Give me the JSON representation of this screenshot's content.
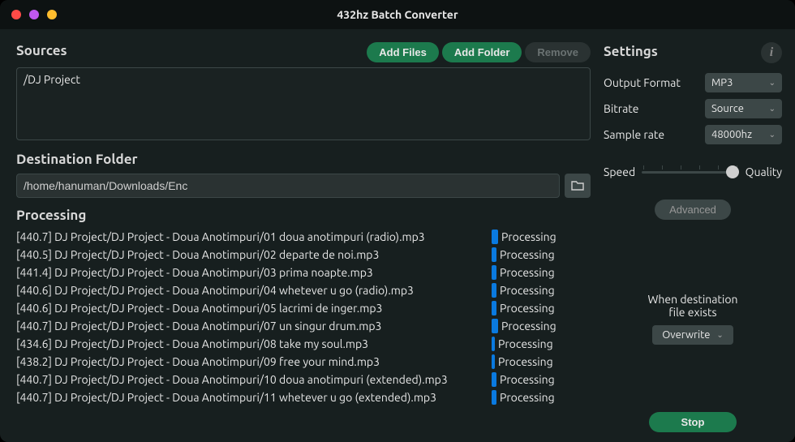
{
  "window": {
    "title": "432hz Batch Converter"
  },
  "sources": {
    "heading": "Sources",
    "add_files": "Add Files",
    "add_folder": "Add Folder",
    "remove": "Remove",
    "items": [
      "/DJ Project"
    ]
  },
  "destination": {
    "heading": "Destination Folder",
    "path": "/home/hanuman/Downloads/Enc"
  },
  "processing": {
    "heading": "Processing",
    "status_label": "Processing",
    "items": [
      {
        "hz": "[440.7]",
        "file": "DJ Project/DJ Project - Doua Anotimpuri/01 doua anotimpuri (radio).mp3",
        "progress": 8
      },
      {
        "hz": "[440.5]",
        "file": "DJ Project/DJ Project - Doua Anotimpuri/02 departe de noi.mp3",
        "progress": 6
      },
      {
        "hz": "[441.4]",
        "file": "DJ Project/DJ Project - Doua Anotimpuri/03 prima noapte.mp3",
        "progress": 6
      },
      {
        "hz": "[440.6]",
        "file": "DJ Project/DJ Project - Doua Anotimpuri/04 whetever u go (radio).mp3",
        "progress": 6
      },
      {
        "hz": "[440.6]",
        "file": "DJ Project/DJ Project - Doua Anotimpuri/05 lacrimi de inger.mp3",
        "progress": 6
      },
      {
        "hz": "[440.7]",
        "file": "DJ Project/DJ Project - Doua Anotimpuri/07 un singur drum.mp3",
        "progress": 8
      },
      {
        "hz": "[434.6]",
        "file": "DJ Project/DJ Project - Doua Anotimpuri/08 take my soul.mp3",
        "progress": 4
      },
      {
        "hz": "[438.2]",
        "file": "DJ Project/DJ Project - Doua Anotimpuri/09 free your mind.mp3",
        "progress": 4
      },
      {
        "hz": "[440.7]",
        "file": "DJ Project/DJ Project - Doua Anotimpuri/10 doua anotimpuri (extended).mp3",
        "progress": 6
      },
      {
        "hz": "[440.7]",
        "file": "DJ Project/DJ Project - Doua Anotimpuri/11 whetever u go (extended).mp3",
        "progress": 6
      }
    ]
  },
  "settings": {
    "heading": "Settings",
    "output_format_label": "Output Format",
    "output_format_value": "MP3",
    "bitrate_label": "Bitrate",
    "bitrate_value": "Source",
    "sample_rate_label": "Sample rate",
    "sample_rate_value": "48000hz",
    "speed_label": "Speed",
    "quality_label": "Quality",
    "advanced": "Advanced",
    "dest_exists_line1": "When destination",
    "dest_exists_line2": "file exists",
    "overwrite": "Overwrite",
    "stop": "Stop"
  }
}
